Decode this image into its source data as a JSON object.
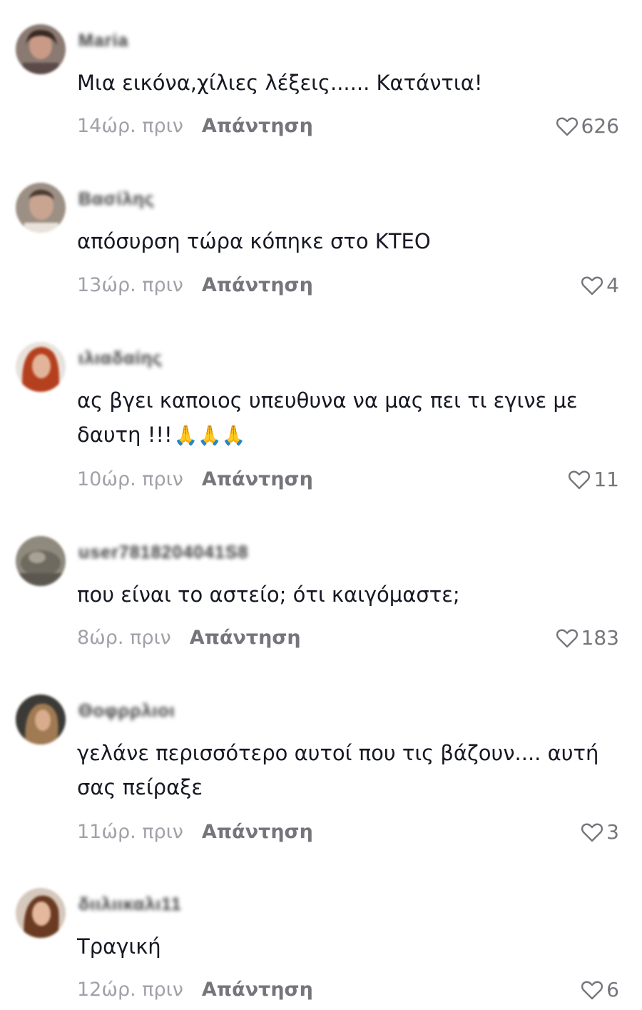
{
  "comments": [
    {
      "username": "Maria",
      "avatar": "avatar-icon",
      "text": "Μια εικόνα,χίλιες λέξεις...... Κατάντια!",
      "emoji": "",
      "time": "14ώρ. πριν",
      "reply_label": "Απάντηση",
      "likes": "626"
    },
    {
      "username": "Βασίλης",
      "avatar": "avatar-icon",
      "text": "απόσυρση τώρα κόπηκε στο ΚΤΕΟ",
      "emoji": "",
      "time": "13ώρ. πριν",
      "reply_label": "Απάντηση",
      "likes": "4"
    },
    {
      "username": "ιλιαδαίης",
      "avatar": "avatar-icon",
      "text": "ας βγει καποιος υπευθυνα να μας πει τι εγινε με δαυτη !!!",
      "emoji": "🙏🙏🙏",
      "time": "10ώρ. πριν",
      "reply_label": "Απάντηση",
      "likes": "11"
    },
    {
      "username": "user7818204041S8",
      "avatar": "avatar-icon",
      "text": "που είναι το αστείο; ότι καιγόμαστε;",
      "emoji": "",
      "time": "8ώρ. πριν",
      "reply_label": "Απάντηση",
      "likes": "183"
    },
    {
      "username": "Θοφρρλιοι",
      "avatar": "avatar-icon",
      "text": "γελάνε περισσότερο αυτοί που τις βάζουν.... αυτή σας πείραξε",
      "emoji": "",
      "time": "11ώρ. πριν",
      "reply_label": "Απάντηση",
      "likes": "3"
    },
    {
      "username": "διιλιικαλι11",
      "avatar": "avatar-icon",
      "text": "Τραγική",
      "emoji": "",
      "time": "12ώρ. πριν",
      "reply_label": "Απάντηση",
      "likes": "6"
    }
  ],
  "colors": {
    "text": "#161823",
    "muted": "#a0a2a8",
    "secondary": "#74767c",
    "background": "#ffffff"
  }
}
